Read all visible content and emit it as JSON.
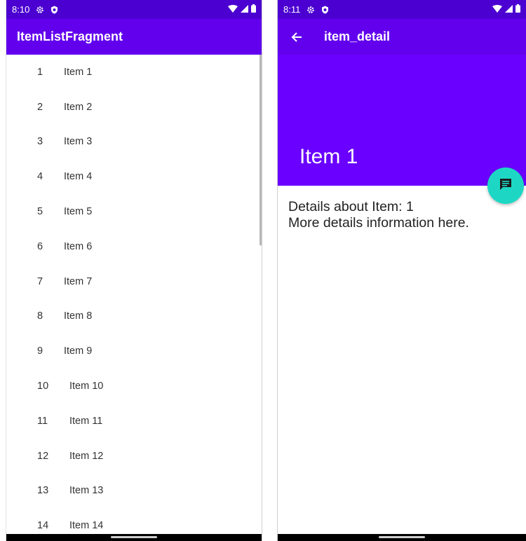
{
  "left": {
    "status": {
      "time": "8:10"
    },
    "title": "ItemListFragment",
    "items": [
      {
        "num": "1",
        "label": "Item 1"
      },
      {
        "num": "2",
        "label": "Item 2"
      },
      {
        "num": "3",
        "label": "Item 3"
      },
      {
        "num": "4",
        "label": "Item 4"
      },
      {
        "num": "5",
        "label": "Item 5"
      },
      {
        "num": "6",
        "label": "Item 6"
      },
      {
        "num": "7",
        "label": "Item 7"
      },
      {
        "num": "8",
        "label": "Item 8"
      },
      {
        "num": "9",
        "label": "Item 9"
      },
      {
        "num": "10",
        "label": "Item 10"
      },
      {
        "num": "11",
        "label": "Item 11"
      },
      {
        "num": "12",
        "label": "Item 12"
      },
      {
        "num": "13",
        "label": "Item 13"
      },
      {
        "num": "14",
        "label": "Item 14"
      }
    ]
  },
  "right": {
    "status": {
      "time": "8:11"
    },
    "toolbar_title": "item_detail",
    "header_title": "Item 1",
    "details_line1": "Details about Item: 1",
    "details_line2": "More details information here."
  },
  "icons": {
    "settings": "gear-icon",
    "shield": "shield-icon",
    "wifi": "wifi-icon",
    "signal": "signal-icon",
    "battery": "battery-icon",
    "back": "back-arrow-icon",
    "fab": "message-icon"
  },
  "colors": {
    "status_bar": "#4b00d1",
    "app_bar": "#6200ee",
    "detail_header": "#6a00ff",
    "fab": "#1dd7c4"
  }
}
